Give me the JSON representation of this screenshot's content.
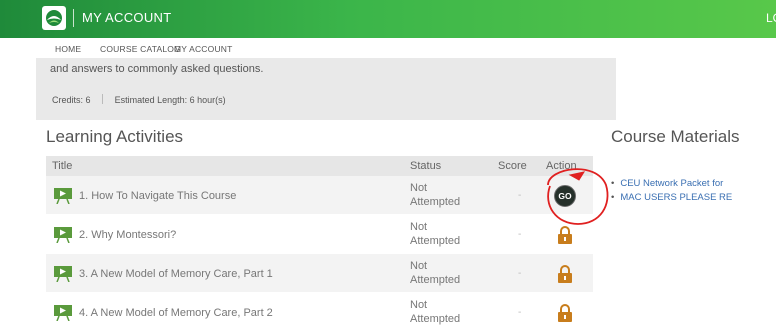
{
  "header": {
    "app_title": "MY ACCOUNT",
    "right_label": "LO",
    "colors": {
      "bar_start": "#1f8a3a",
      "bar_end": "#58c84a"
    }
  },
  "nav": {
    "items": [
      {
        "label": "HOME"
      },
      {
        "label": "COURSE CATALOG"
      },
      {
        "label": "MY ACCOUNT"
      }
    ]
  },
  "summary": {
    "description": "and answers to commonly asked questions.",
    "credits_label": "Credits:",
    "credits_value": "6",
    "length_label": "Estimated Length:",
    "length_value": "6 hour(s)"
  },
  "learning": {
    "heading": "Learning Activities",
    "columns": {
      "title": "Title",
      "status": "Status",
      "score": "Score",
      "action": "Action"
    },
    "rows": [
      {
        "title": "1. How To Navigate This Course",
        "status_line1": "Not",
        "status_line2": "Attempted",
        "score": "-",
        "action": "go",
        "action_label": "GO",
        "icon": "presentation-icon"
      },
      {
        "title": "2. Why Montessori?",
        "status_line1": "Not",
        "status_line2": "Attempted",
        "score": "-",
        "action": "locked",
        "icon": "presentation-icon"
      },
      {
        "title": "3. A New Model of Memory Care, Part 1",
        "status_line1": "Not",
        "status_line2": "Attempted",
        "score": "-",
        "action": "locked",
        "icon": "presentation-icon"
      },
      {
        "title": "4. A New Model of Memory Care, Part 2",
        "status_line1": "Not",
        "status_line2": "Attempted",
        "score": "-",
        "action": "locked",
        "icon": "presentation-icon"
      }
    ]
  },
  "materials": {
    "heading": "Course Materials",
    "items": [
      {
        "label": "CEU Network Packet for"
      },
      {
        "label": "MAC USERS PLEASE RE"
      }
    ]
  },
  "colors": {
    "accent_green": "#3bb54a",
    "lock_orange": "#c87d1c",
    "link_blue": "#3a6fb2",
    "annotation_red": "#e02020"
  }
}
